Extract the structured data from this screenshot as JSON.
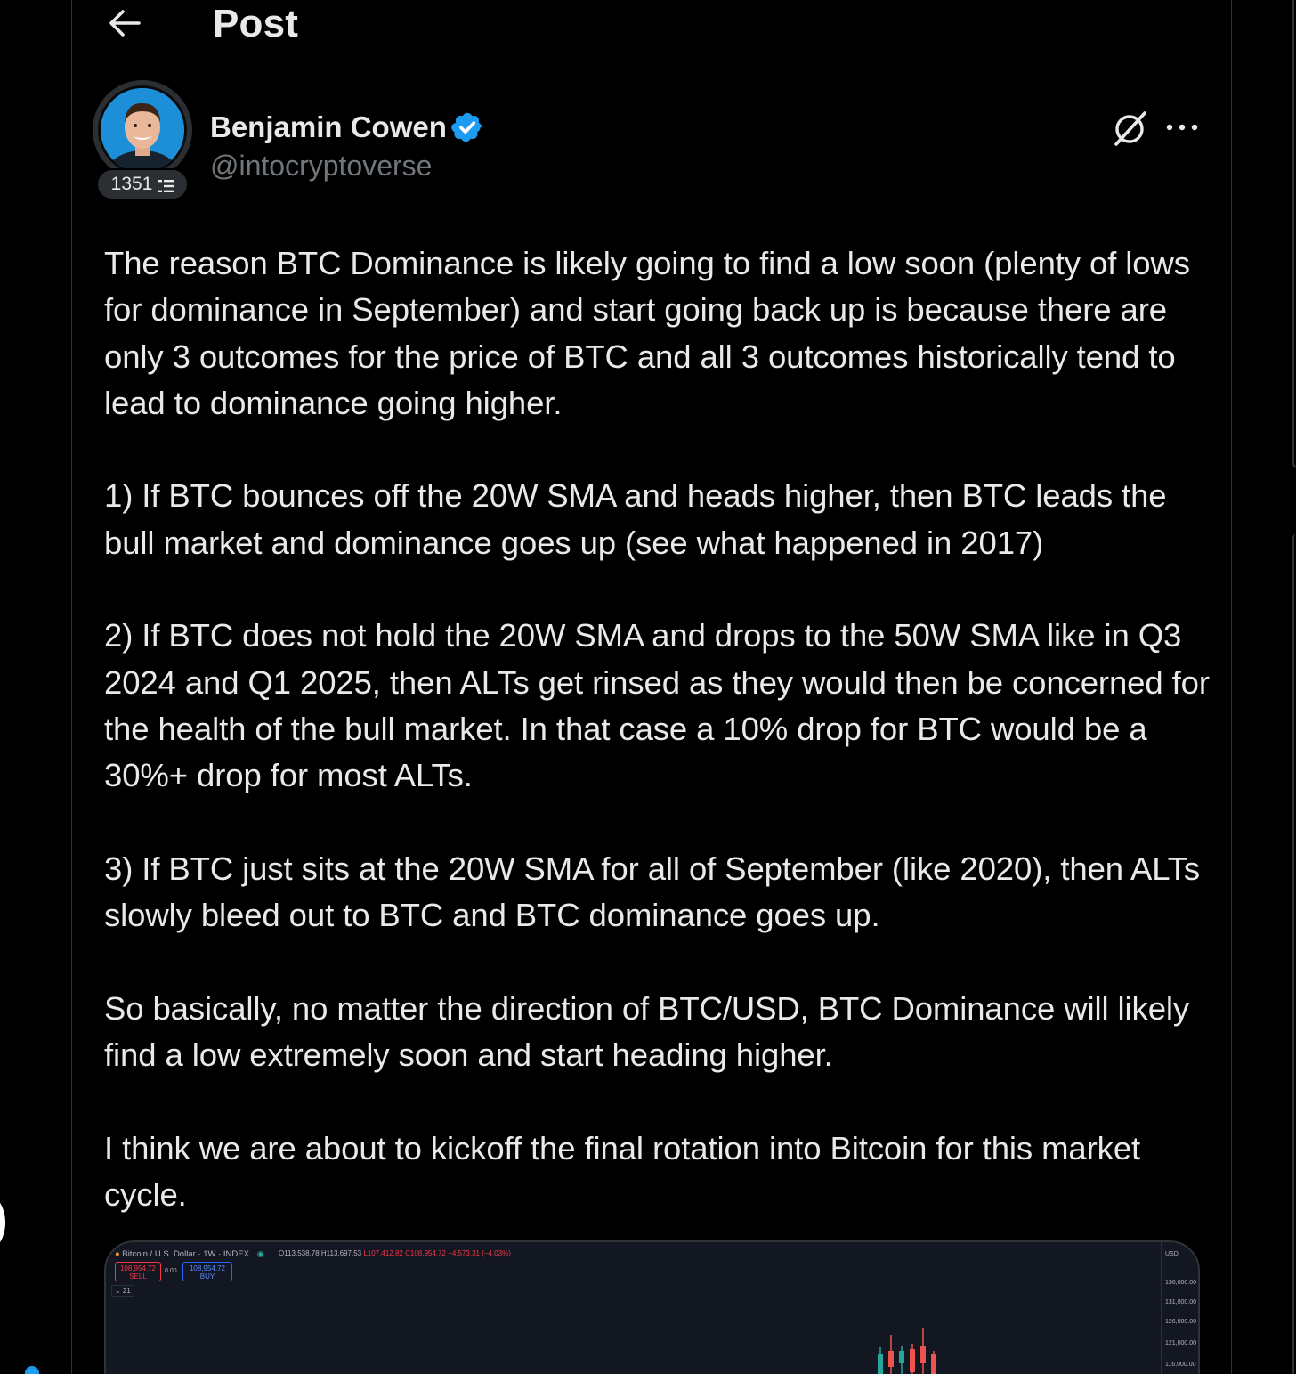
{
  "header": {
    "title": "Post"
  },
  "author": {
    "name": "Benjamin Cowen",
    "handle": "@intocryptoverse",
    "badge_count": "1351"
  },
  "post": {
    "paragraphs": [
      "The reason BTC Dominance is likely going to find a low soon (plenty of lows for dominance in September) and start going back up is because there are only 3 outcomes for the price of BTC and all 3 outcomes historically tend to lead to dominance going higher.",
      "1) If BTC bounces off the 20W SMA and heads higher, then BTC leads the bull market and dominance goes up (see what happened in 2017)",
      "2) If BTC does not hold the 20W SMA and drops to the 50W SMA like in Q3 2024 and Q1 2025, then ALTs get rinsed as they would then be concerned for the health of the bull market. In that case a 10% drop for BTC would be a 30%+ drop for most ALTs.",
      "3) If BTC just sits at the 20W SMA for all of September (like 2020), then ALTs slowly bleed out to BTC and BTC dominance goes up.",
      "So basically, no matter the direction of BTC/USD, BTC Dominance will likely find a low extremely soon and start heading higher.",
      "I think we are about to kickoff the final rotation into Bitcoin for this market cycle."
    ]
  },
  "media": {
    "symbol_line": "Bitcoin / U.S. Dollar · 1W · INDEX",
    "ohlc_open": "O113,538.78",
    "ohlc_high": "H113,697.53",
    "ohlc_low": "L107,412.82",
    "ohlc_close": "C108,954.72",
    "ohlc_change": "−4,573.31 (−4.03%)",
    "sell_price": "108,954.72",
    "sell_label": "SELL",
    "spread": "0.00",
    "buy_price": "108,954.72",
    "buy_label": "BUY",
    "indicator": "⌄ 21",
    "axis_currency": "USD",
    "axis_ticks": [
      "136,000.00",
      "131,000.00",
      "126,000.00",
      "121,000.00",
      "116,000.00"
    ]
  },
  "colors": {
    "accent": "#1d9bf0",
    "text_primary": "#e7e9ea",
    "text_secondary": "#71767b",
    "border": "#2f3336",
    "candle_up": "#26a69a",
    "candle_down": "#ef5350"
  },
  "icons": {
    "back": "arrow-left-icon",
    "verified": "verified-badge-icon",
    "grok": "grok-icon",
    "more": "more-horizontal-icon",
    "badge": "list-icon"
  }
}
